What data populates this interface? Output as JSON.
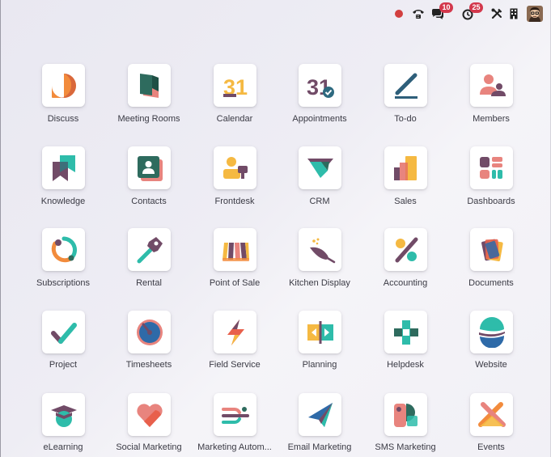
{
  "topbar": {
    "messages_count": "10",
    "activity_count": "25"
  },
  "colors": {
    "purple": "#714b67",
    "teal": "#2ebcaa",
    "orange": "#f28b3c",
    "yellow": "#f5b942",
    "pink": "#e8847e",
    "blue": "#2e6aa8",
    "notification_red": "#d3384c"
  },
  "apps": [
    {
      "label": "Discuss",
      "icon": "discuss-icon"
    },
    {
      "label": "Meeting Rooms",
      "icon": "meeting-rooms-icon"
    },
    {
      "label": "Calendar",
      "icon": "calendar-icon",
      "glyph": "31"
    },
    {
      "label": "Appointments",
      "icon": "appointments-icon",
      "glyph": "31"
    },
    {
      "label": "To-do",
      "icon": "todo-icon"
    },
    {
      "label": "Members",
      "icon": "members-icon"
    },
    {
      "label": "Knowledge",
      "icon": "knowledge-icon"
    },
    {
      "label": "Contacts",
      "icon": "contacts-icon"
    },
    {
      "label": "Frontdesk",
      "icon": "frontdesk-icon"
    },
    {
      "label": "CRM",
      "icon": "crm-icon"
    },
    {
      "label": "Sales",
      "icon": "sales-icon"
    },
    {
      "label": "Dashboards",
      "icon": "dashboards-icon"
    },
    {
      "label": "Subscriptions",
      "icon": "subscriptions-icon"
    },
    {
      "label": "Rental",
      "icon": "rental-icon"
    },
    {
      "label": "Point of Sale",
      "icon": "point-of-sale-icon"
    },
    {
      "label": "Kitchen Display",
      "icon": "kitchen-display-icon"
    },
    {
      "label": "Accounting",
      "icon": "accounting-icon"
    },
    {
      "label": "Documents",
      "icon": "documents-icon"
    },
    {
      "label": "Project",
      "icon": "project-icon"
    },
    {
      "label": "Timesheets",
      "icon": "timesheets-icon"
    },
    {
      "label": "Field Service",
      "icon": "field-service-icon"
    },
    {
      "label": "Planning",
      "icon": "planning-icon"
    },
    {
      "label": "Helpdesk",
      "icon": "helpdesk-icon"
    },
    {
      "label": "Website",
      "icon": "website-icon"
    },
    {
      "label": "eLearning",
      "icon": "elearning-icon"
    },
    {
      "label": "Social Marketing",
      "icon": "social-marketing-icon"
    },
    {
      "label": "Marketing Autom...",
      "icon": "marketing-automation-icon"
    },
    {
      "label": "Email Marketing",
      "icon": "email-marketing-icon"
    },
    {
      "label": "SMS Marketing",
      "icon": "sms-marketing-icon"
    },
    {
      "label": "Events",
      "icon": "events-icon"
    }
  ]
}
